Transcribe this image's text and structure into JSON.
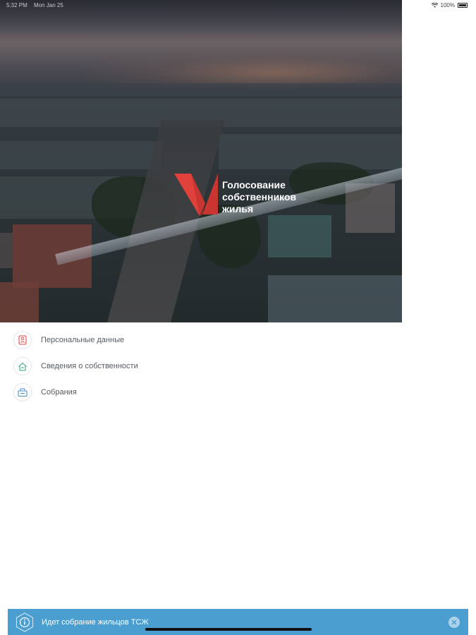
{
  "status_bar": {
    "time": "5:32 PM",
    "date": "Mon Jan 25",
    "battery": "100%"
  },
  "brand": {
    "line1": "Голосование",
    "line2": "собственников",
    "line3": "жилья",
    "colors": {
      "logo_red": "#e0413b",
      "logo_dark_red": "#b92f2b"
    }
  },
  "menu": {
    "items": [
      {
        "label": "Персональные данные",
        "icon": "id-card-icon"
      },
      {
        "label": "Сведения о собственности",
        "icon": "house-icon"
      },
      {
        "label": "Собрания",
        "icon": "ballot-box-icon"
      }
    ]
  },
  "notification": {
    "text": "Идет собрание жильцов ТСЖ",
    "icon": "info-icon",
    "close_icon": "close-icon",
    "color": "#4a9ed0"
  }
}
